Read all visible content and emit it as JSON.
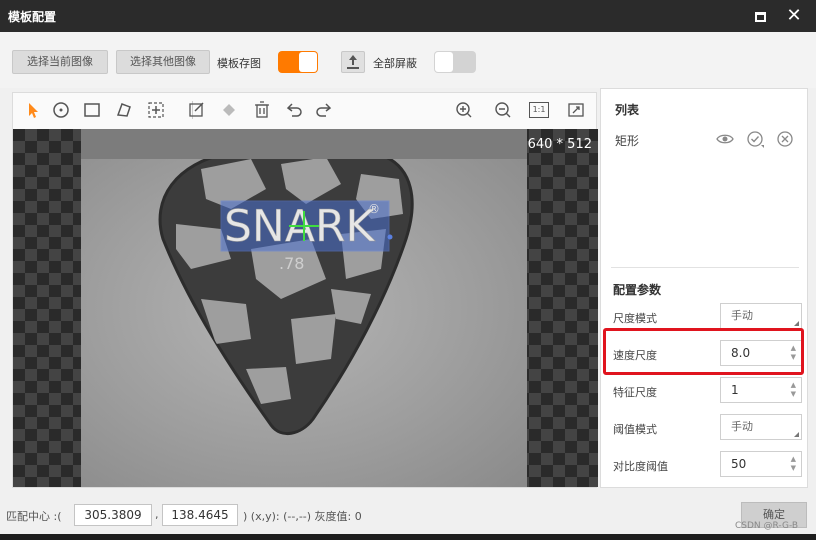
{
  "window": {
    "title": "模板配置"
  },
  "toolbar": {
    "select_current": "选择当前图像",
    "select_other": "选择其他图像",
    "template_save_label": "模板存图",
    "template_save_on": true,
    "mask_all_label": "全部屏蔽",
    "mask_all_on": false,
    "accent_color": "#ff7a00"
  },
  "canvas": {
    "tools": [
      "pointer-icon",
      "circle-icon",
      "rectangle-icon",
      "polygon-icon",
      "crosshair-icon",
      "edit-icon",
      "fill-icon",
      "delete-icon",
      "undo-icon",
      "redo-icon",
      "zoom-in-icon",
      "zoom-out-icon",
      "actual-size-icon",
      "fit-icon"
    ],
    "one_to_one": "1:1",
    "resolution": "640 * 512",
    "image_text": {
      "brand": "SNARK",
      "reg": "®",
      "number": ".78"
    }
  },
  "right_panel": {
    "list_title": "列表",
    "list_items": [
      {
        "label": "矩形"
      }
    ],
    "params_title": "配置参数",
    "params": [
      {
        "label": "尺度模式",
        "value": "手动",
        "type": "select"
      },
      {
        "label": "速度尺度",
        "value": "8.0",
        "type": "spin"
      },
      {
        "label": "特征尺度",
        "value": "1",
        "type": "spin"
      },
      {
        "label": "阈值模式",
        "value": "手动",
        "type": "select"
      },
      {
        "label": "对比度阈值",
        "value": "50",
        "type": "spin"
      }
    ],
    "highlight_color": "#e0141e"
  },
  "status": {
    "match_center_label": "匹配中心 :(",
    "x_value": "305.3809",
    "comma": ",",
    "y_value": "138.4645",
    "coord_text": ")   (x,y): (--,--) 灰度值: 0",
    "ok_label": "确定"
  },
  "watermark": "CSDN @R-G-B"
}
